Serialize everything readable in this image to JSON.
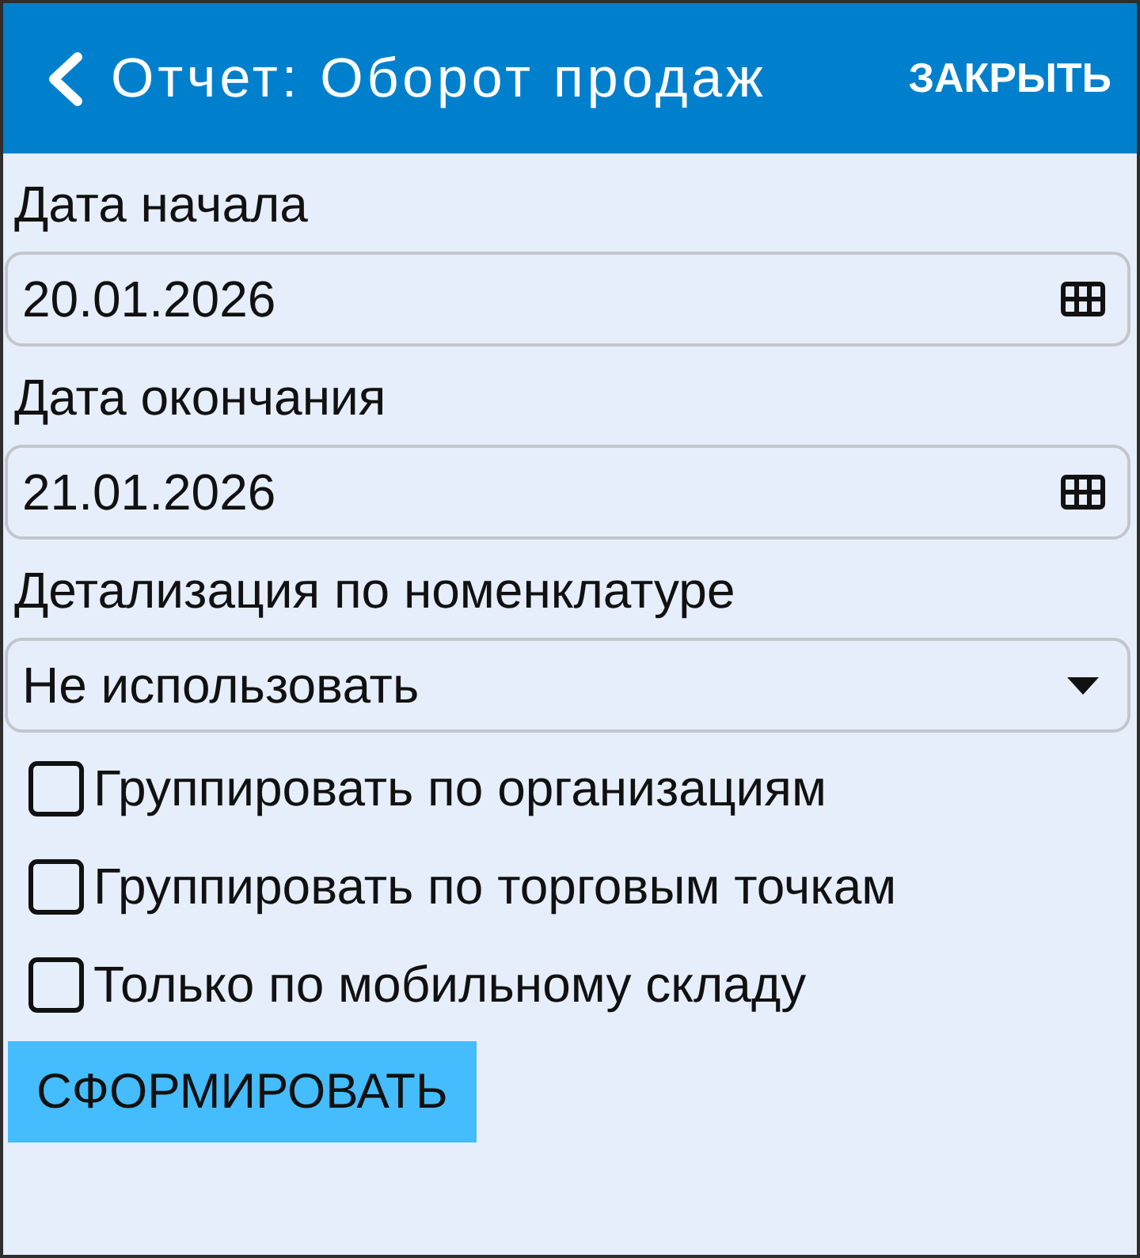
{
  "header": {
    "title": "Отчет: Оборот продаж",
    "close_button": "ЗАКРЫТЬ"
  },
  "fields": [
    {
      "kind": "date",
      "label": "Дата начала",
      "value": "20.01.2026"
    },
    {
      "kind": "date",
      "label": "Дата окончания",
      "value": "21.01.2026"
    },
    {
      "kind": "select",
      "label": "Детализация по номенклатуре",
      "value": "Не использовать"
    }
  ],
  "options": [
    {
      "label": "Группировать по организациям",
      "checked": false
    },
    {
      "label": "Группировать по торговым точкам",
      "checked": false
    },
    {
      "label": "Только по мобильному складу",
      "checked": false
    }
  ],
  "submit_button": "СФОРМИРОВАТЬ"
}
